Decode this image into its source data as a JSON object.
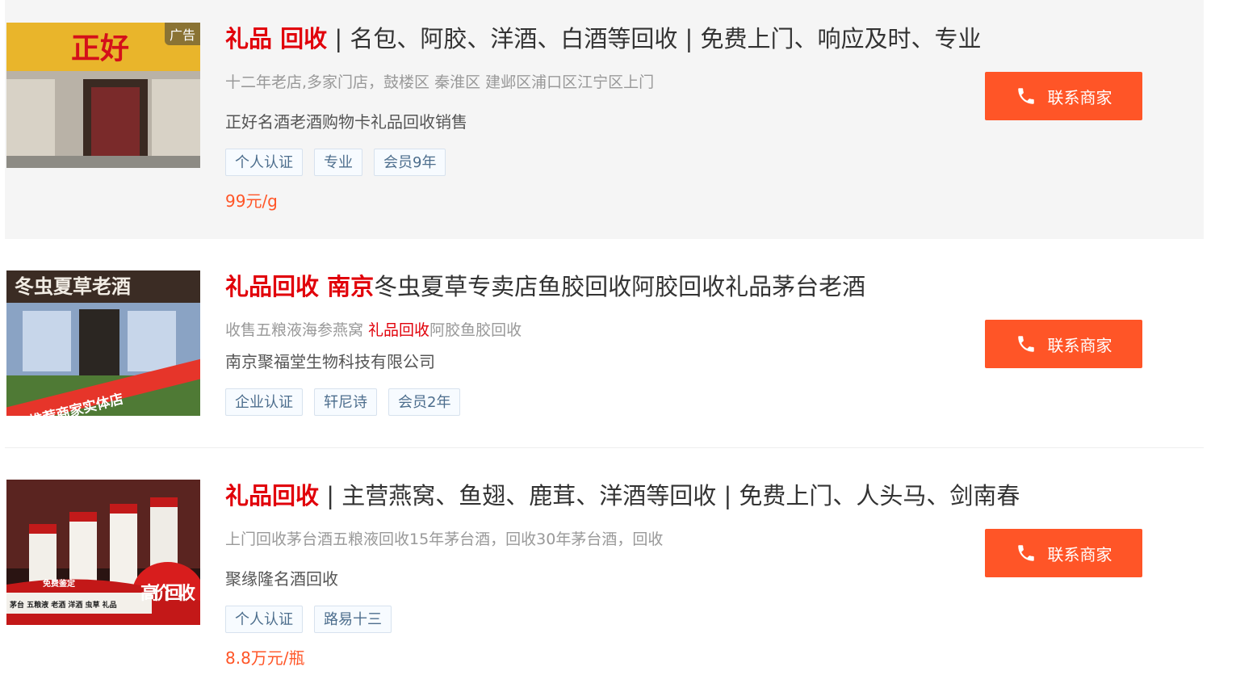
{
  "listings": [
    {
      "ad_tag": "广告",
      "title_highlight": "礼品 回收",
      "title_rest": " | 名包、阿胶、洋酒、白酒等回收 | 免费上门、响应及时、专业",
      "desc": "十二年老店,多家门店，鼓楼区 秦淮区 建邺区浦口区江宁区上门",
      "company": "正好名酒老酒购物卡礼品回收销售",
      "tags": [
        "个人认证",
        "专业",
        "会员9年"
      ],
      "price": "99元/g",
      "button_label": "联系商家",
      "image_sign_text": "正好"
    },
    {
      "title_highlight": "礼品回收 南京",
      "title_rest": "冬虫夏草专卖店鱼胶回收阿胶回收礼品茅台老酒",
      "desc_before": "收售五粮液海参燕窝 ",
      "desc_red": "礼品回收",
      "desc_after": "阿胶鱼胶回收",
      "company": "南京聚福堂生物科技有限公司",
      "tags": [
        "企业认证",
        "轩尼诗",
        "会员2年"
      ],
      "button_label": "联系商家",
      "image_sign_text": "冬虫夏草老酒",
      "image_banner_text": "推荐商家实体店"
    },
    {
      "title_highlight": "礼品回收",
      "title_rest": " | 主营燕窝、鱼翅、鹿茸、洋酒等回收 | 免费上门、人头马、剑南春",
      "desc": "上门回收茅台酒五粮液回收15年茅台酒，回收30年茅台酒，回收",
      "company": "聚缘隆名酒回收",
      "tags": [
        "个人认证",
        "路易十三"
      ],
      "price": "8.8万元/瓶",
      "button_label": "联系商家",
      "image_badge_text": "高价回收",
      "image_strip_title": "免费鉴定",
      "image_strip_text": "茅台 五粮液 老酒 洋酒 虫草 礼品"
    }
  ],
  "colors": {
    "accent": "#ff5527",
    "highlight": "#e1000a",
    "tag_text": "#4d6e8d"
  },
  "icons": {
    "button_icon": "phone-icon"
  }
}
